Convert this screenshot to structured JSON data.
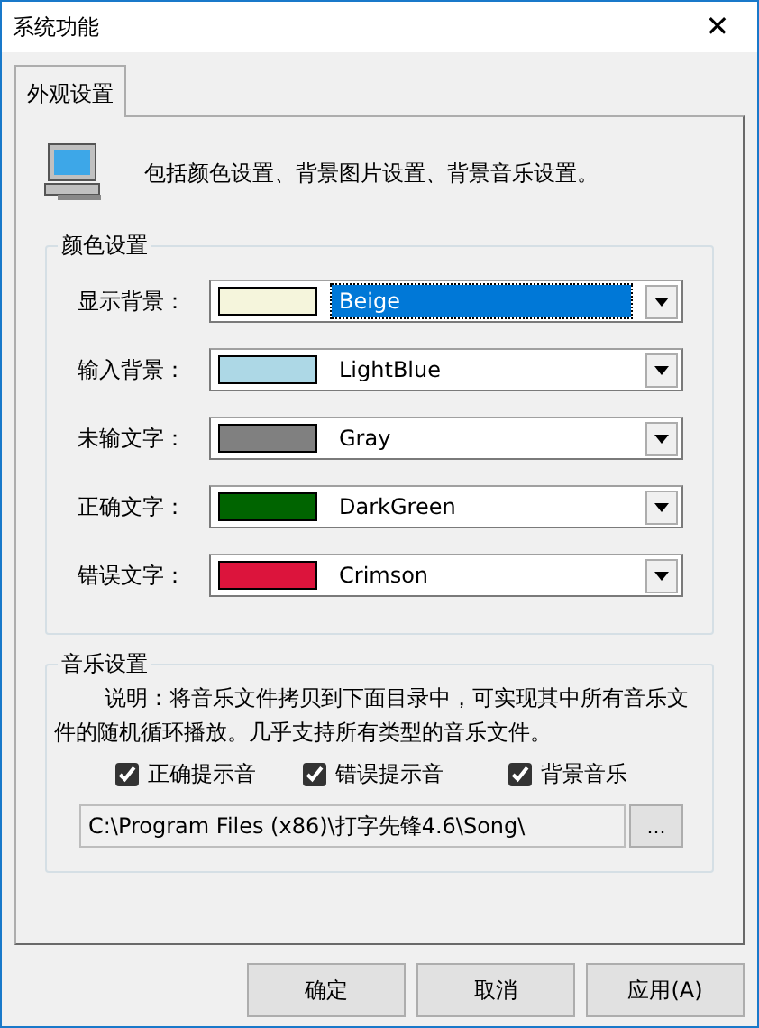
{
  "window": {
    "title": "系统功能",
    "close": "✕"
  },
  "tabs": [
    {
      "label": "外观设置",
      "selected": true
    }
  ],
  "description": "包括颜色设置、背景图片设置、背景音乐设置。",
  "color_group": {
    "title": "颜色设置",
    "rows": [
      {
        "label": "显示背景：",
        "value": "Beige",
        "color": "#f5f5dc",
        "selected": true
      },
      {
        "label": "输入背景：",
        "value": "LightBlue",
        "color": "#add8e6",
        "selected": false
      },
      {
        "label": "未输文字：",
        "value": "Gray",
        "color": "#808080",
        "selected": false
      },
      {
        "label": "正确文字：",
        "value": "DarkGreen",
        "color": "#006400",
        "selected": false
      },
      {
        "label": "错误文字：",
        "value": "Crimson",
        "color": "#dc143c",
        "selected": false
      }
    ]
  },
  "music_group": {
    "title": "音乐设置",
    "note": "说明：将音乐文件拷贝到下面目录中，可实现其中所有音乐文件的随机循环播放。几乎支持所有类型的音乐文件。",
    "checkboxes": [
      {
        "label": "正确提示音",
        "checked": true
      },
      {
        "label": "错误提示音",
        "checked": true
      },
      {
        "label": "背景音乐",
        "checked": true
      }
    ],
    "path": "C:\\Program Files (x86)\\打字先锋4.6\\Song\\",
    "browse": "..."
  },
  "buttons": [
    "确定",
    "取消",
    "应用(A)"
  ]
}
